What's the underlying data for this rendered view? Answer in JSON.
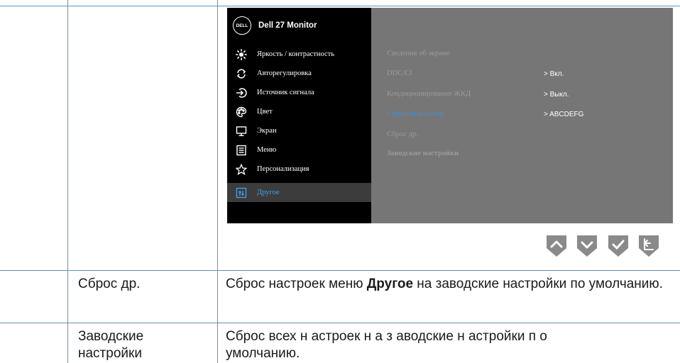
{
  "osd": {
    "logo_text": "DELL",
    "monitor_title": "Dell 27 Monitor",
    "menu": [
      {
        "label": "Яркость / контрастность",
        "icon": "brightness-icon"
      },
      {
        "label": "Авторегулировка",
        "icon": "auto-adjust-icon"
      },
      {
        "label": "Источник сигнала",
        "icon": "input-source-icon"
      },
      {
        "label": "Цвет",
        "icon": "color-palette-icon"
      },
      {
        "label": "Экран",
        "icon": "display-icon"
      },
      {
        "label": "Меню",
        "icon": "menu-icon"
      },
      {
        "label": "Персонализация",
        "icon": "star-icon"
      },
      {
        "label": "Другое",
        "icon": "others-icon"
      }
    ],
    "submenu": [
      {
        "label": "Сведения об экране",
        "value": ""
      },
      {
        "label": "DDC/CI",
        "value": "> Вкл."
      },
      {
        "label": "Кондиционирование ЖКД",
        "value": "> Выкл."
      },
      {
        "label": "Сервисный номер",
        "value": "> ABCDEFG"
      },
      {
        "label": "Сброс др.",
        "value": ""
      },
      {
        "label": "Заводские настройки",
        "value": ""
      }
    ],
    "nav_buttons": [
      "up-arrow-icon",
      "down-arrow-icon",
      "check-icon",
      "back-icon"
    ]
  },
  "table": {
    "rows": [
      {
        "name": "Сброс др.",
        "desc_before": "Сброс настроек меню ",
        "desc_bold": "Другое",
        "desc_after": " на заводские настройки по умолчанию."
      },
      {
        "name_line1": "Заводские",
        "name_line2": "настройки",
        "desc_line1": "Сброс всех н астроек н а з аводские н астройки п о",
        "desc_line2": "умолчанию."
      }
    ]
  },
  "colors": {
    "table_border": "#5c93c2",
    "osd_left_bg": "#000000",
    "osd_right_bg": "#767676",
    "highlight": "#3a92dd",
    "nav_button": "#8a8a8a"
  }
}
